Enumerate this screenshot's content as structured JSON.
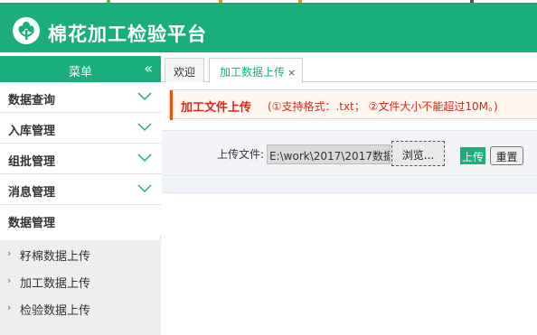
{
  "app": {
    "title": "棉花加工检验平台",
    "logo_icon": "cotton-flower-icon"
  },
  "colors": {
    "brand": "#1aae7a",
    "notice_text": "#d8281b",
    "notice_accent": "#e8530e"
  },
  "sidebar": {
    "header": "菜单",
    "collapse_glyph": "«",
    "items": [
      {
        "label": "数据查询",
        "icon": "chevron-down-icon"
      },
      {
        "label": "入库管理",
        "icon": "chevron-down-icon"
      },
      {
        "label": "组批管理",
        "icon": "chevron-down-icon"
      },
      {
        "label": "消息管理",
        "icon": "chevron-down-icon"
      },
      {
        "label": "数据管理"
      }
    ],
    "sub_items": [
      {
        "label": "籽棉数据上传"
      },
      {
        "label": "加工数据上传"
      },
      {
        "label": "检验数据上传"
      }
    ],
    "sub_arrow": "›"
  },
  "tabs": [
    {
      "label": "欢迎"
    },
    {
      "label": "加工数据上传",
      "close": "×",
      "active": true
    }
  ],
  "notice": {
    "title": "加工文件上传",
    "hint": "(①支持格式：.txt；  ②文件大小不能超过10M。)"
  },
  "upload": {
    "label": "上传文件:",
    "file_path": "E:\\work\\2017\\2017数据",
    "browse_label": "浏览...",
    "upload_label": "上传",
    "reset_label": "重置"
  }
}
